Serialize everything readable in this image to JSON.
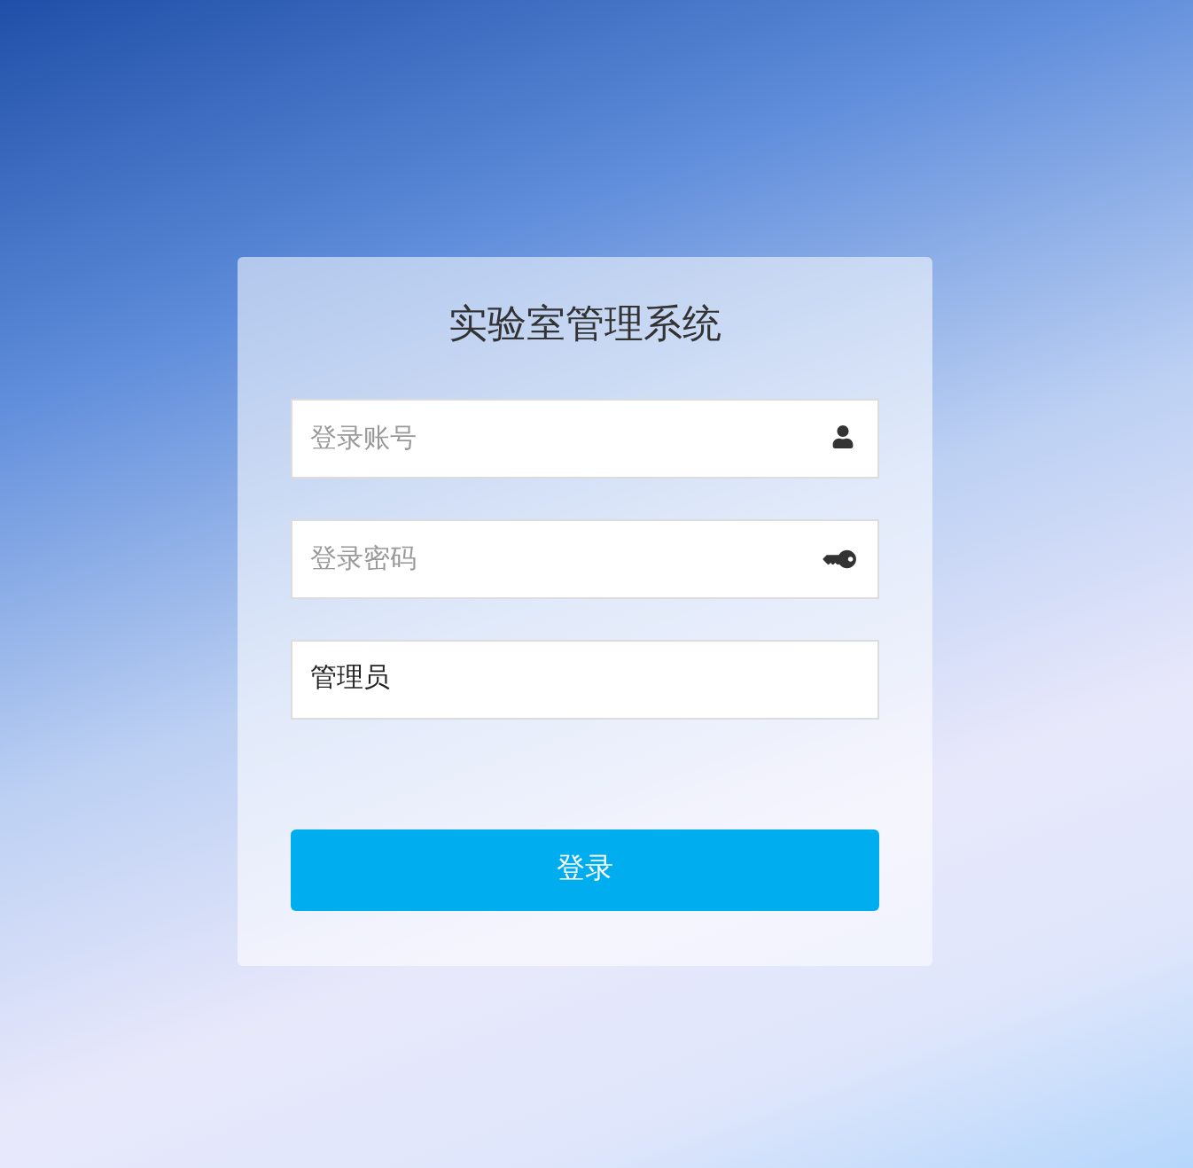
{
  "title": "实验室管理系统",
  "fields": [
    {
      "kind": "account",
      "placeholder": "登录账号"
    },
    {
      "kind": "password",
      "placeholder": "登录密码"
    },
    {
      "kind": "role",
      "value": "管理员"
    }
  ],
  "login_button": {
    "label": "登录"
  }
}
